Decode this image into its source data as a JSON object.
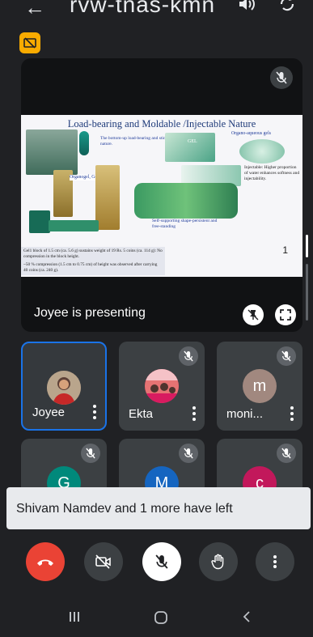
{
  "top_bar": {
    "meeting_code": "rvw-tnas-kmn"
  },
  "presentation": {
    "presenter_label": "Joyee is presenting",
    "slide": {
      "title": "Load-bearing and Moldable /Injectable Nature",
      "caption_bottom_up": "The bottom-up load-bearing and sticky nature.",
      "label_organogel": "Organogel, Gel1",
      "label_organo_aqueous": "Organo-aqueous gels",
      "label_gel_tag": "GEL",
      "injectable_text": "Injectable: Higher proportion of water enhances softness and injectability.",
      "self_supporting_text": "Self-supporting shape-persistent and free-standing",
      "gel_desc_1": "Gel1 block of 1.5 cm (ca. 5.6 g) sustains weight of 19 Rs. 5 coins (ca. 114 g): No compression in the block height.",
      "gel_desc_2": "~50 % compression (1.5 cm to 0.75 cm) of height was observed after carrying 40 coins (ca. 240 g).",
      "page_number": "1"
    }
  },
  "participants": [
    {
      "name": "Joyee",
      "avatar_color": "#8d6e63",
      "initial": "",
      "muted": false,
      "active": true
    },
    {
      "name": "Ekta",
      "avatar_color": "#c2185b",
      "initial": "",
      "muted": true,
      "active": false
    },
    {
      "name": "moni...",
      "avatar_color": "#a1887f",
      "initial": "m",
      "muted": true,
      "active": false
    },
    {
      "name": "",
      "avatar_color": "#00897b",
      "initial": "G",
      "muted": true,
      "active": false
    },
    {
      "name": "",
      "avatar_color": "#1565c0",
      "initial": "M",
      "muted": true,
      "active": false
    },
    {
      "name": "",
      "avatar_color": "#c2185b",
      "initial": "c",
      "muted": true,
      "active": false
    }
  ],
  "toast": {
    "message": "Shivam Namdev and 1 more have left"
  },
  "colors": {
    "end_call": "#ea4335",
    "control_bg": "#3c4043",
    "accent": "#1a73e8",
    "badge": "#f9ab00"
  },
  "icons": [
    "back-arrow-icon",
    "audio-output-icon",
    "camera-flip-icon",
    "presenting-badge-icon",
    "mic-off-icon",
    "pin-off-icon",
    "fullscreen-icon",
    "more-vert-icon",
    "end-call-icon",
    "camera-off-icon",
    "raise-hand-icon",
    "recents-icon",
    "home-icon",
    "back-icon"
  ]
}
